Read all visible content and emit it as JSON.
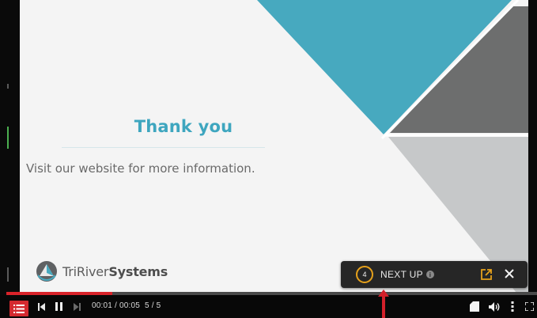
{
  "slide": {
    "title": "Thank you",
    "subtitle": "Visit our website for more information.",
    "brand": {
      "name_light": "TriRiver",
      "name_bold": "Systems",
      "logo_icon": "tririver-logo-icon"
    },
    "colors": {
      "teal": "#3ea6bf",
      "dark_gray": "#6b6b6b",
      "light_gray": "#c7c9ca",
      "background": "#f4f4f4"
    }
  },
  "next_up": {
    "countdown": "4",
    "label": "NEXT UP",
    "info_icon": "info-icon",
    "popout_icon": "external-link-icon",
    "close_icon": "close-icon",
    "accent_color": "#e6a11b"
  },
  "player": {
    "progress_fraction": 0.2,
    "progress_color": "#d8232a",
    "time": "00:01 / 00:05",
    "slide_counter": "5 / 5",
    "controls": {
      "menu_icon": "menu-list-icon",
      "prev_icon": "skip-previous-icon",
      "pause_icon": "pause-icon",
      "next_icon": "skip-next-icon",
      "notes_icon": "notes-icon",
      "volume_icon": "volume-icon",
      "more_icon": "more-vertical-icon",
      "fullscreen_icon": "fullscreen-icon"
    }
  }
}
